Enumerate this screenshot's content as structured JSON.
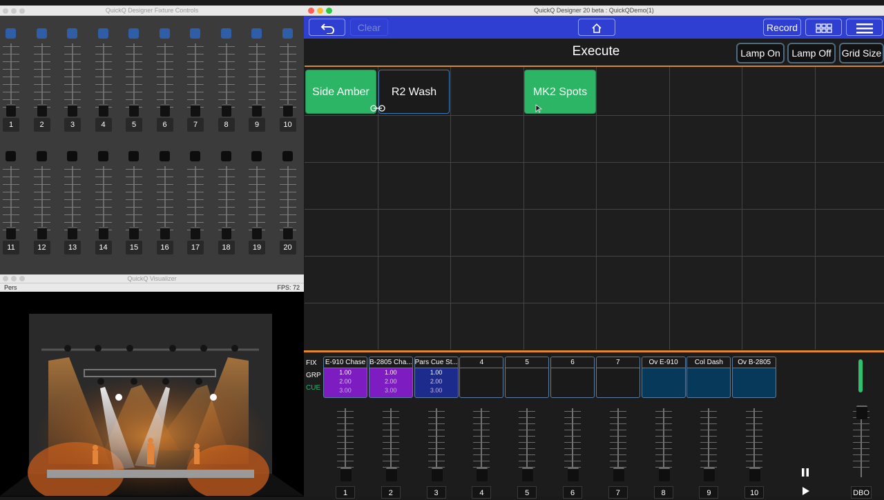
{
  "fixture_window": {
    "title": "QuickQ Designer Fixture Controls",
    "row1_numbers": [
      "1",
      "2",
      "3",
      "4",
      "5",
      "6",
      "7",
      "8",
      "9",
      "10"
    ],
    "row2_numbers": [
      "11",
      "12",
      "13",
      "14",
      "15",
      "16",
      "17",
      "18",
      "19",
      "20"
    ],
    "row1_button_color": "#2f5ea6",
    "row2_button_color": "#0d0d0d"
  },
  "visualizer": {
    "title": "QuickQ Visualizer",
    "mode": "Pers",
    "fps": "FPS: 72"
  },
  "designer": {
    "title": "QuickQ Designer 20 beta : QuickQDemo(1)",
    "toolbar": {
      "back_icon": "undo-arrow-icon",
      "clear": "Clear",
      "home_icon": "home-icon",
      "record": "Record",
      "grid_icon": "grid-icon",
      "menu_icon": "hamburger-menu-icon"
    },
    "page_title": "Execute",
    "header_buttons": [
      "Lamp On",
      "Lamp Off",
      "Grid Size"
    ],
    "tiles": [
      {
        "label": "Side Amber",
        "color": "#2bb565"
      },
      {
        "label": "R2 Wash",
        "color": "#1b1b1b"
      },
      {
        "label": "MK2 Spots",
        "color": "#2bb565"
      }
    ],
    "playback_labels": {
      "fix": "FIX",
      "grp": "GRP",
      "cue": "CUE"
    },
    "playbacks": [
      {
        "title": "E-910 Chase",
        "values": [
          "1.00",
          "2.00",
          "3.00"
        ],
        "color": "#7d1cc0"
      },
      {
        "title": "B-2805 Cha...",
        "values": [
          "1.00",
          "2.00",
          "3.00"
        ],
        "color": "#7d1cc0"
      },
      {
        "title": "Pars Cue St...",
        "values": [
          "1.00",
          "2.00",
          "3.00"
        ],
        "color": "#1d2c8c"
      },
      {
        "title": "4",
        "values": [],
        "color": "#1a1a1a"
      },
      {
        "title": "5",
        "values": [],
        "color": "#1a1a1a"
      },
      {
        "title": "6",
        "values": [],
        "color": "#1a1a1a"
      },
      {
        "title": "7",
        "values": [],
        "color": "#1a1a1a"
      },
      {
        "title": "Ov E-910",
        "values": [],
        "color": "#073a5a"
      },
      {
        "title": "Col Dash",
        "values": [],
        "color": "#073a5a"
      },
      {
        "title": "Ov B-2805",
        "values": [],
        "color": "#073a5a"
      }
    ],
    "fader_numbers": [
      "1",
      "2",
      "3",
      "4",
      "5",
      "6",
      "7",
      "8",
      "9",
      "10"
    ],
    "dbo": "DBO",
    "pause_icon": "pause-icon",
    "play_icon": "play-icon"
  }
}
